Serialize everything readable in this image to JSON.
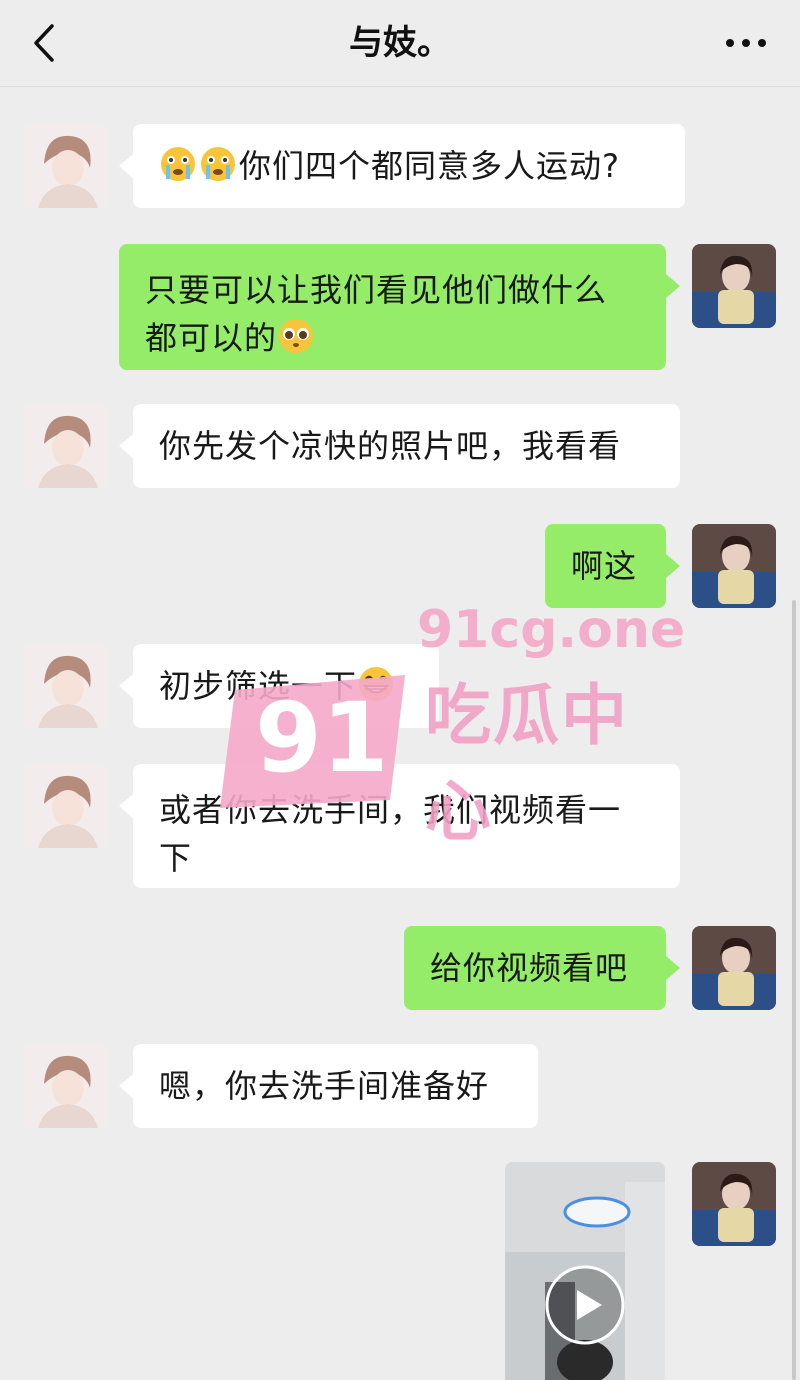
{
  "header": {
    "title": "与妓。",
    "back_icon": "chevron-left-icon",
    "more_icon": "more-dots-icon"
  },
  "messages": [
    {
      "side": "in",
      "emoji": "crying-face-icon",
      "text": "你们四个都同意多人运动?"
    },
    {
      "side": "out",
      "line1": "只要可以让我们看见他们做什么",
      "line2": "都可以的",
      "emoji": "pleading-face-icon"
    },
    {
      "side": "in",
      "text": "你先发个凉快的照片吧，我看看"
    },
    {
      "side": "out",
      "text": "啊这"
    },
    {
      "side": "in",
      "text": "初步筛选一下",
      "emoji": "grinning-face-icon"
    },
    {
      "side": "in",
      "line1": "或者你去洗手间，我们视频看一",
      "line2": "下"
    },
    {
      "side": "out",
      "text": "给你视频看吧"
    },
    {
      "side": "in",
      "text": "嗯，你去洗手间准备好"
    },
    {
      "side": "out",
      "type": "video",
      "icon": "play-icon"
    }
  ],
  "watermark": {
    "site": "91cg.one",
    "name": "吃瓜中心",
    "logo": "91"
  },
  "colors": {
    "background": "#ededed",
    "incoming_bubble": "#ffffff",
    "outgoing_bubble": "#95ec69",
    "watermark": "#f4a8c8"
  }
}
